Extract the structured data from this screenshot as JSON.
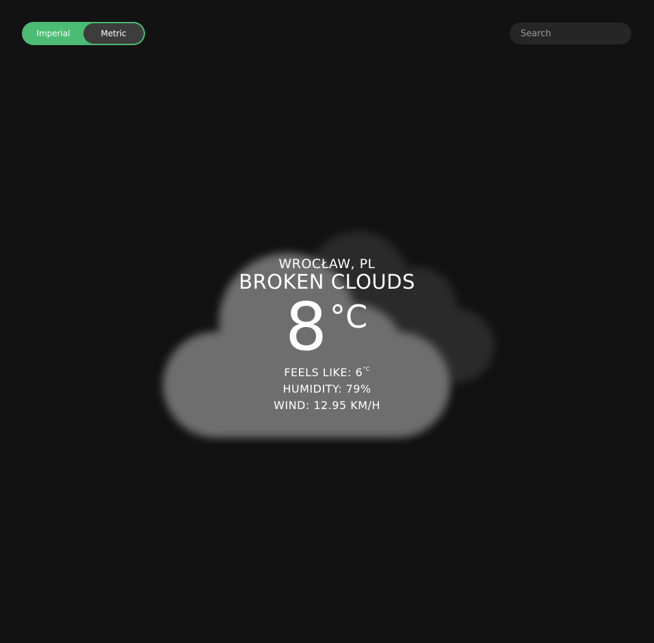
{
  "units": {
    "imperial_label": "Imperial",
    "metric_label": "Metric",
    "selected": "Metric",
    "accent_color": "#4cbb73"
  },
  "search": {
    "placeholder": "Search",
    "value": ""
  },
  "weather": {
    "location": "WROCŁAW, PL",
    "condition": "BROKEN CLOUDS",
    "temperature": "8",
    "temperature_unit": "°C",
    "feels_like_label": "FEELS LIKE: ",
    "feels_like_value": "6",
    "feels_like_unit": "°C",
    "humidity": "HUMIDITY: 79%",
    "wind": "WIND: 12.95 KM/H",
    "icon": "broken-clouds-icon"
  },
  "colors": {
    "background": "#121212",
    "search_bg": "#262626",
    "toggle_knob": "#3d3d3d"
  }
}
